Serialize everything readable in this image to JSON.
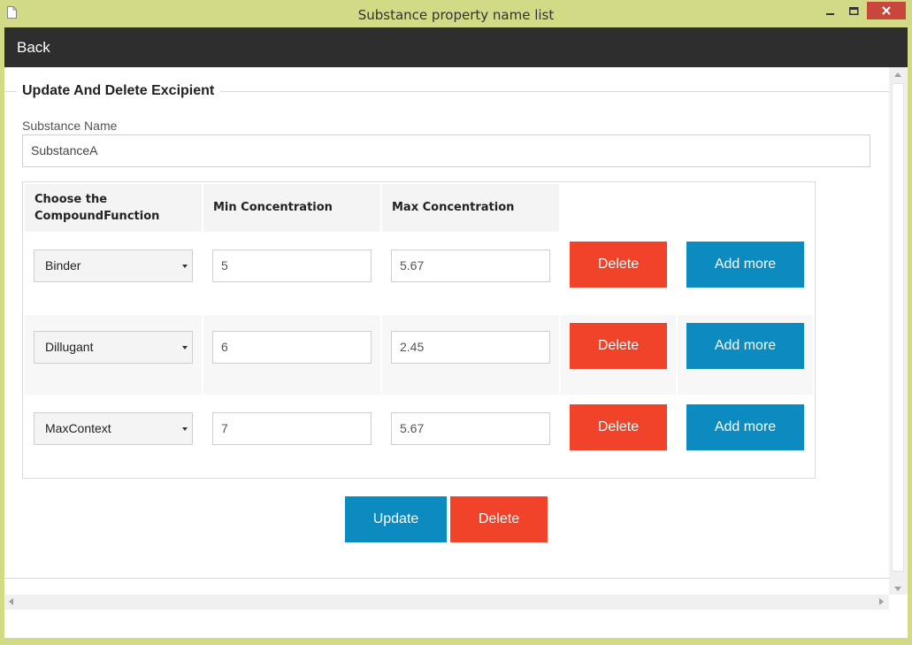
{
  "window": {
    "title": "Substance property name list"
  },
  "nav": {
    "back_label": "Back"
  },
  "form": {
    "legend": "Update And Delete Excipient",
    "substance_label": "Substance Name",
    "substance_value": "SubstanceA"
  },
  "table": {
    "headers": {
      "function_line1": "Choose the",
      "function_line2": "CompoundFunction",
      "min": "Min Concentration",
      "max": "Max Concentration"
    },
    "rows": [
      {
        "function": "Binder",
        "min": "5",
        "max": "5.67",
        "delete_label": "Delete",
        "add_label": "Add more"
      },
      {
        "function": "Dillugant",
        "min": "6",
        "max": "2.45",
        "delete_label": "Delete",
        "add_label": "Add more"
      },
      {
        "function": "MaxContext",
        "min": "7",
        "max": "5.67",
        "delete_label": "Delete",
        "add_label": "Add more"
      }
    ]
  },
  "actions": {
    "update_label": "Update",
    "delete_label": "Delete"
  },
  "colors": {
    "danger": "#f0432a",
    "primary": "#0b8bbf",
    "titlebar": "#d2da86",
    "navbar": "#2e2e2e"
  }
}
